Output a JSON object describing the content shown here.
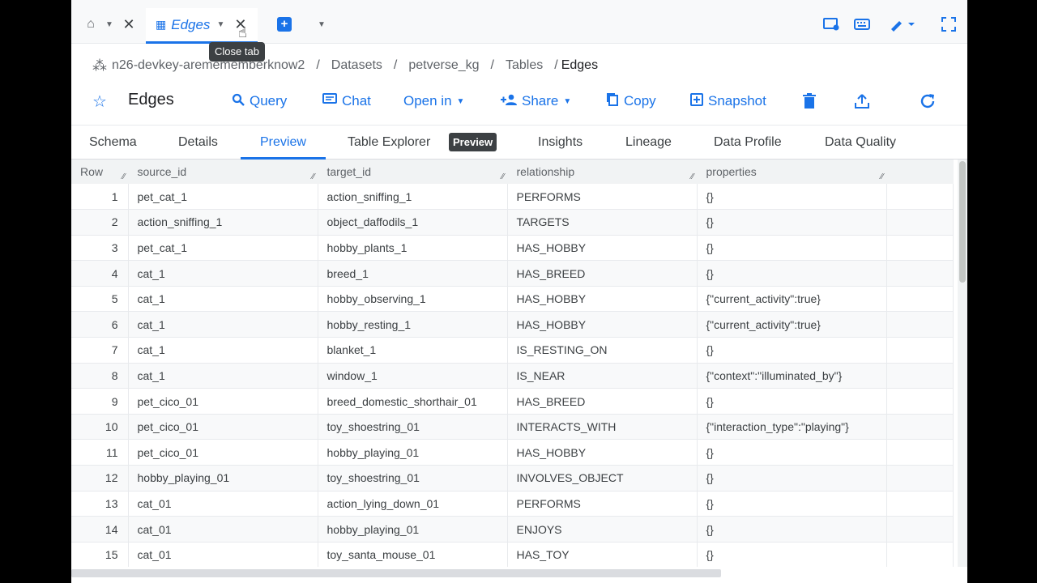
{
  "tabbar": {
    "home_icon": "home-icon",
    "tab_title": "Edges",
    "tooltip": "Close tab"
  },
  "breadcrumb": {
    "project": "n26-devkey-aremememberknow2",
    "datasets": "Datasets",
    "dataset": "petverse_kg",
    "tables": "Tables",
    "table": "Edges",
    "sep": "/"
  },
  "toolbar": {
    "table_name": "Edges",
    "query": "Query",
    "chat": "Chat",
    "open_in": "Open in",
    "share": "Share",
    "copy": "Copy",
    "snapshot": "Snapshot"
  },
  "subtabs": [
    "Schema",
    "Details",
    "Preview",
    "Table Explorer",
    "Insights",
    "Lineage",
    "Data Profile",
    "Data Quality"
  ],
  "preview_badge": "Preview",
  "grid": {
    "columns": [
      "Row",
      "source_id",
      "target_id",
      "relationship",
      "properties"
    ],
    "rows": [
      [
        "1",
        "pet_cat_1",
        "action_sniffing_1",
        "PERFORMS",
        "{}"
      ],
      [
        "2",
        "action_sniffing_1",
        "object_daffodils_1",
        "TARGETS",
        "{}"
      ],
      [
        "3",
        "pet_cat_1",
        "hobby_plants_1",
        "HAS_HOBBY",
        "{}"
      ],
      [
        "4",
        "cat_1",
        "breed_1",
        "HAS_BREED",
        "{}"
      ],
      [
        "5",
        "cat_1",
        "hobby_observing_1",
        "HAS_HOBBY",
        "{\"current_activity\":true}"
      ],
      [
        "6",
        "cat_1",
        "hobby_resting_1",
        "HAS_HOBBY",
        "{\"current_activity\":true}"
      ],
      [
        "7",
        "cat_1",
        "blanket_1",
        "IS_RESTING_ON",
        "{}"
      ],
      [
        "8",
        "cat_1",
        "window_1",
        "IS_NEAR",
        "{\"context\":\"illuminated_by\"}"
      ],
      [
        "9",
        "pet_cico_01",
        "breed_domestic_shorthair_01",
        "HAS_BREED",
        "{}"
      ],
      [
        "10",
        "pet_cico_01",
        "toy_shoestring_01",
        "INTERACTS_WITH",
        "{\"interaction_type\":\"playing\"}"
      ],
      [
        "11",
        "pet_cico_01",
        "hobby_playing_01",
        "HAS_HOBBY",
        "{}"
      ],
      [
        "12",
        "hobby_playing_01",
        "toy_shoestring_01",
        "INVOLVES_OBJECT",
        "{}"
      ],
      [
        "13",
        "cat_01",
        "action_lying_down_01",
        "PERFORMS",
        "{}"
      ],
      [
        "14",
        "cat_01",
        "hobby_playing_01",
        "ENJOYS",
        "{}"
      ],
      [
        "15",
        "cat_01",
        "toy_santa_mouse_01",
        "HAS_TOY",
        "{}"
      ]
    ]
  },
  "colors": {
    "accent": "#1a73e8",
    "text": "#3c4043",
    "header_bg": "#f1f3f4"
  }
}
